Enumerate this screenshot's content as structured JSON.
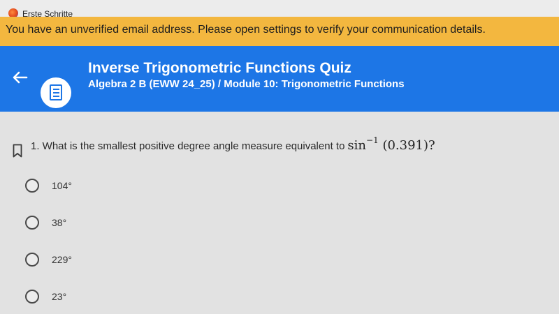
{
  "app": {
    "title": "Erste Schritte"
  },
  "banner": {
    "message": "You have an unverified email address. Please open settings to verify your communication details."
  },
  "header": {
    "title": "Inverse Trigonometric Functions Quiz",
    "subtitle": "Algebra 2 B (EWW 24_25) / Module 10: Trigonometric Functions"
  },
  "question": {
    "text": "1. What is the smallest positive degree angle measure equivalent to",
    "func": "sin",
    "exponent": "−1",
    "argument": "(0.391)?"
  },
  "options": [
    {
      "label": "104°"
    },
    {
      "label": "38°"
    },
    {
      "label": "229°"
    },
    {
      "label": "23°"
    }
  ],
  "colors": {
    "banner": "#f3b73f",
    "header": "#1d76e6",
    "background": "#e2e2e2"
  }
}
